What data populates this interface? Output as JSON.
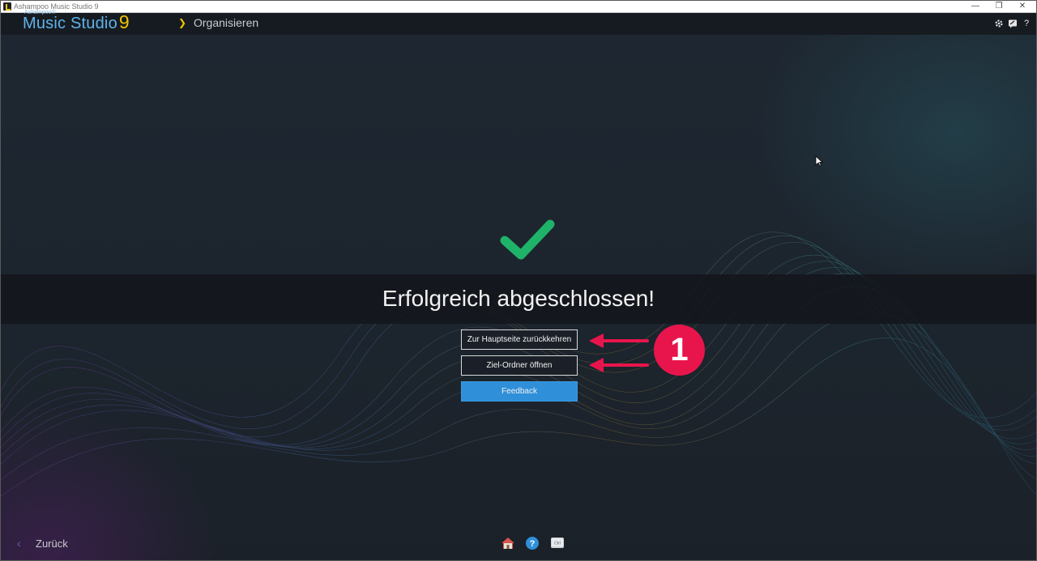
{
  "window": {
    "title": "Ashampoo Music Studio 9",
    "controls": {
      "minimize": "—",
      "maximize": "❐",
      "close": "✕"
    }
  },
  "header": {
    "brand_small": "Ashampoo®",
    "brand_name": "Music Studio",
    "brand_version": "9",
    "breadcrumb_chevron": "❯",
    "breadcrumb": "Organisieren",
    "icons": [
      "gear-icon",
      "chat-icon",
      "help-icon"
    ],
    "help_glyph": "?"
  },
  "main": {
    "status_icon": "checkmark-icon",
    "status_text": "Erfolgreich abgeschlossen!",
    "buttons": {
      "home": "Zur Hauptseite zurückkehren",
      "open_folder": "Ziel-Ordner öffnen",
      "feedback": "Feedback"
    }
  },
  "annotation": {
    "badge": "1"
  },
  "footer": {
    "back_chevron": "‹",
    "back_label": "Zurück",
    "icons": [
      "home-icon",
      "help-circle-icon",
      "keyboard-ctrl-icon"
    ],
    "ctrl_label": "Ctrl"
  },
  "colors": {
    "accent_blue": "#2f8fd8",
    "brand_blue": "#5fb3ea",
    "brand_yellow": "#f0c400",
    "success_green": "#1fb36a",
    "annotation_red": "#e8154c"
  }
}
